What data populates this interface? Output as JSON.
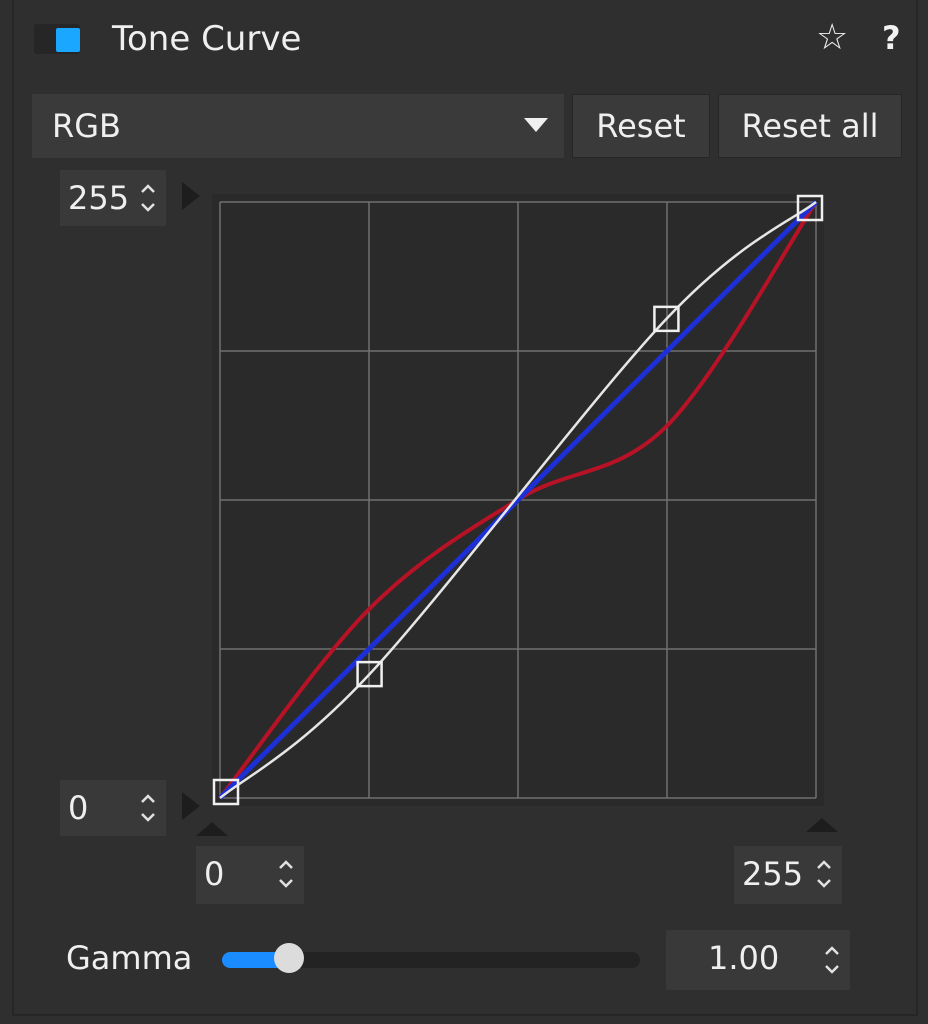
{
  "header": {
    "title": "Tone Curve",
    "enable_color": "#19a7ff",
    "star_icon": "☆",
    "help_icon": "?"
  },
  "channel": {
    "selected": "RGB"
  },
  "buttons": {
    "reset": "Reset",
    "reset_all": "Reset all"
  },
  "spinners": {
    "output_max": "255",
    "output_min": "0",
    "input_min": "0",
    "input_max": "255"
  },
  "gamma": {
    "label": "Gamma",
    "value": "1.00",
    "slider_fraction": 0.16
  },
  "curve": {
    "range": [
      0,
      255
    ],
    "grid_divisions": 4,
    "colors": {
      "rgb_curve": "#e6e6e6",
      "blue_curve": "#1d2fd6",
      "red_curve": "#b81226",
      "grid": "#707070",
      "background": "#2a2a2a"
    },
    "rgb_points": [
      [
        0,
        0
      ],
      [
        64,
        53
      ],
      [
        191,
        205
      ],
      [
        255,
        255
      ]
    ],
    "red_points": [
      [
        0,
        0
      ],
      [
        64,
        81
      ],
      [
        128,
        128
      ],
      [
        191,
        159
      ],
      [
        255,
        255
      ]
    ]
  }
}
